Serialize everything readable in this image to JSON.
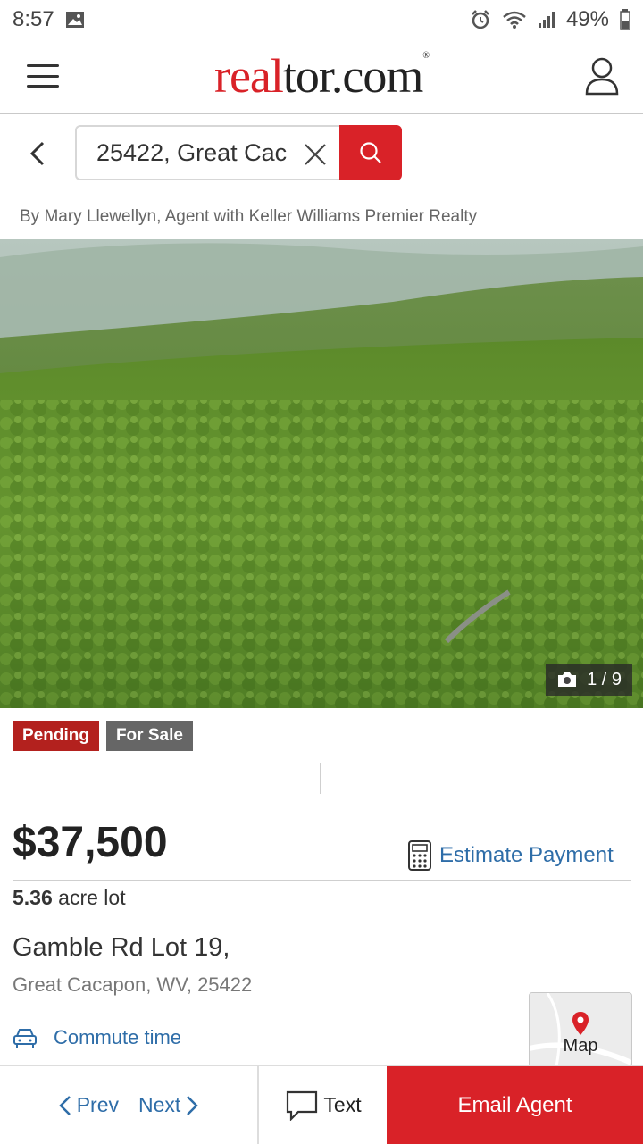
{
  "status_bar": {
    "time": "8:57",
    "battery": "49%"
  },
  "header": {
    "logo_red": "real",
    "logo_black": "tor.com",
    "logo_mark": "®"
  },
  "search": {
    "value": "25422, Great Cac"
  },
  "listing": {
    "byline": "By Mary Llewellyn, Agent with Keller Williams Premier Realty",
    "photo_counter": "1 / 9",
    "badges": {
      "pending": "Pending",
      "for_sale": "For Sale"
    },
    "price": "$37,500",
    "estimate_payment": "Estimate Payment",
    "lot_size": "5.36",
    "lot_label": "acre lot",
    "address_line1": "Gamble Rd Lot 19,",
    "address_line2": "Great Cacapon, WV, 25422",
    "commute": "Commute time",
    "map_label": "Map"
  },
  "bottom_bar": {
    "prev": "Prev",
    "next": "Next",
    "text": "Text",
    "email": "Email Agent"
  },
  "colors": {
    "brand_red": "#d92228",
    "link_blue": "#2e6da8",
    "pending_red": "#b3211e",
    "for_sale_gray": "#666666"
  },
  "icons": [
    "image-icon",
    "alarm-icon",
    "wifi-icon",
    "signal-icon",
    "battery-icon",
    "menu-icon",
    "user-icon",
    "back-icon",
    "close-icon",
    "search-icon",
    "camera-icon",
    "calculator-icon",
    "car-icon",
    "map-pin-icon",
    "chevron-left-icon",
    "chevron-right-icon",
    "chat-icon"
  ]
}
